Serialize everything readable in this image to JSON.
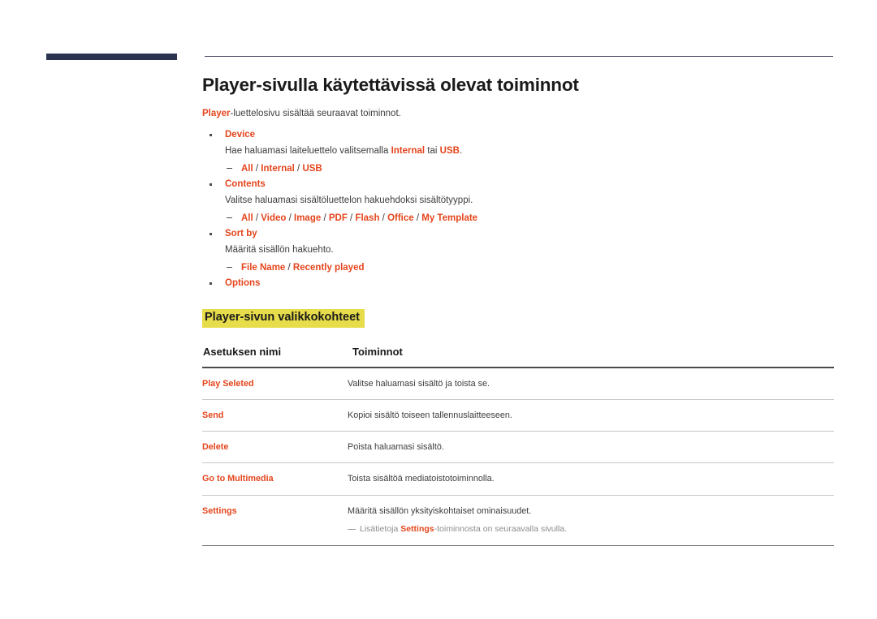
{
  "colors": {
    "accent_orange": "#e4451c",
    "highlight_yellow": "#e7dc4a",
    "navy_bar": "#2b3350",
    "body_text": "#3c3c3c",
    "note_gray": "#8c8c8c"
  },
  "header": {
    "navy_bar_name": "decorative-navy-bar",
    "rule_name": "decorative-header-rule"
  },
  "page": {
    "title": "Player-sivulla käytettävissä olevat toiminnot",
    "intro_prefix": "Player",
    "intro_rest": "-luettelosivu sisältää seuraavat toiminnot."
  },
  "bullets": [
    {
      "label": "Device",
      "desc_parts": [
        {
          "text": "Hae haluamasi laiteluettelo valitsemalla ",
          "style": "plain"
        },
        {
          "text": "Internal",
          "style": "orange-b"
        },
        {
          "text": " tai ",
          "style": "plain"
        },
        {
          "text": "USB",
          "style": "orange-b"
        },
        {
          "text": ".",
          "style": "plain"
        }
      ],
      "options": [
        "All",
        "Internal",
        "USB"
      ]
    },
    {
      "label": "Contents",
      "desc_parts": [
        {
          "text": "Valitse haluamasi sisältöluettelon hakuehdoksi sisältötyyppi.",
          "style": "plain"
        }
      ],
      "options": [
        "All",
        "Video",
        "Image",
        "PDF",
        "Flash",
        "Office",
        "My Template"
      ]
    },
    {
      "label": "Sort by",
      "desc_parts": [
        {
          "text": "Määritä sisällön hakuehto.",
          "style": "plain"
        }
      ],
      "options": [
        "File Name",
        "Recently played"
      ]
    },
    {
      "label": "Options",
      "desc_parts": [],
      "options": []
    }
  ],
  "section_heading": "Player-sivun valikkokohteet",
  "table": {
    "headers": [
      "Asetuksen nimi",
      "Toiminnot"
    ],
    "rows": [
      {
        "name": "Play Seleted",
        "desc": "Valitse haluamasi sisältö ja toista se.",
        "note": null
      },
      {
        "name": "Send",
        "desc": "Kopioi sisältö toiseen tallennuslaitteeseen.",
        "note": null
      },
      {
        "name": "Delete",
        "desc": "Poista haluamasi sisältö.",
        "note": null
      },
      {
        "name": "Go to Multimedia",
        "desc": "Toista sisältöä mediatoistotoiminnolla.",
        "note": null
      },
      {
        "name": "Settings",
        "desc": "Määritä sisällön yksityiskohtaiset ominaisuudet.",
        "note": {
          "before": "Lisätietoja ",
          "bold": "Settings",
          "after": "-toiminnosta on seuraavalla sivulla."
        }
      }
    ]
  }
}
